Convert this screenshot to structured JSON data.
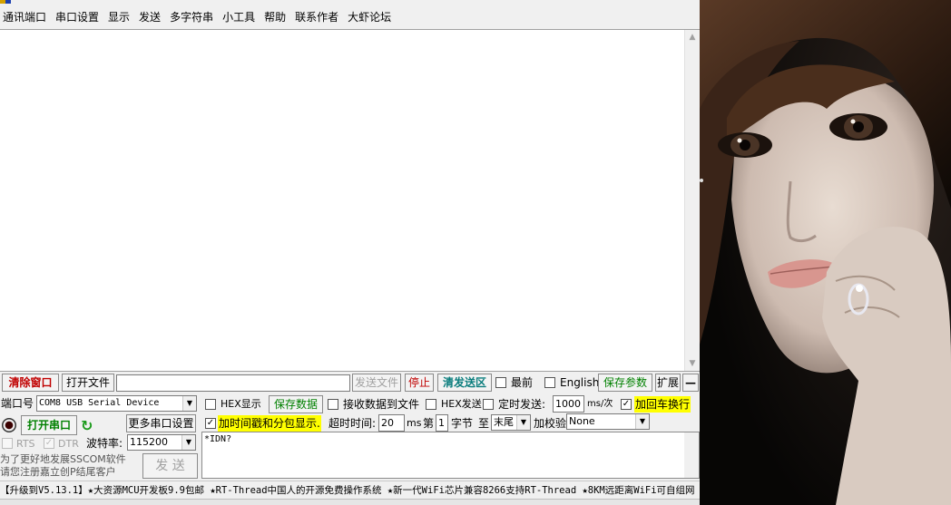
{
  "menu": [
    "通讯端口",
    "串口设置",
    "显示",
    "发送",
    "多字符串",
    "小工具",
    "帮助",
    "联系作者",
    "大虾论坛"
  ],
  "toolbar": {
    "clear_window": "清除窗口",
    "open_file": "打开文件",
    "file_path": "",
    "send_file": "发送文件",
    "stop": "停止",
    "clear_send": "清发送区",
    "topmost": "最前",
    "english": "English",
    "save_params": "保存参数",
    "expand": "扩展",
    "collapse": "—"
  },
  "port": {
    "port_label": "端口号",
    "port_value": "COM8 USB Serial Device",
    "hex_display": "HEX显示",
    "save_data": "保存数据",
    "recv_to_file": "接收数据到文件",
    "hex_send": "HEX发送",
    "timed_send": "定时发送:",
    "interval": "1000",
    "interval_unit": "ms/次",
    "append_crlf": "加回车换行",
    "open_port": "打开串口",
    "more_settings": "更多串口设置",
    "timestamp": "加时间戳和分包显示.",
    "timeout_label": "超时时间:",
    "timeout_value": "20",
    "timeout_unit": "ms",
    "nth": "第",
    "byte_index": "1",
    "byte_label": "字节",
    "to": "至",
    "end_value": "末尾",
    "checksum_label": "加校验",
    "checksum_value": "None",
    "rts": "RTS",
    "dtr": "DTR",
    "baud_label": "波特率:",
    "baud_value": "115200",
    "send": "发 送",
    "send_text": "*IDN?",
    "promo1": "为了更好地发展SSCOM软件",
    "promo2": "请您注册嘉立创P结尾客户"
  },
  "ticker": "【升级到V5.13.1】★大资源MCU开发板9.9包邮 ★RT-Thread中国人的开源免费操作系统 ★新一代WiFi芯片兼容8266支持RT-Thread ★8KM远距离WiFi可自组网",
  "colors": {
    "highlight_yellow": "#ffff00",
    "clear_red": "#c00000",
    "save_green": "#008000",
    "clear_send_teal": "#0a7d7d"
  }
}
